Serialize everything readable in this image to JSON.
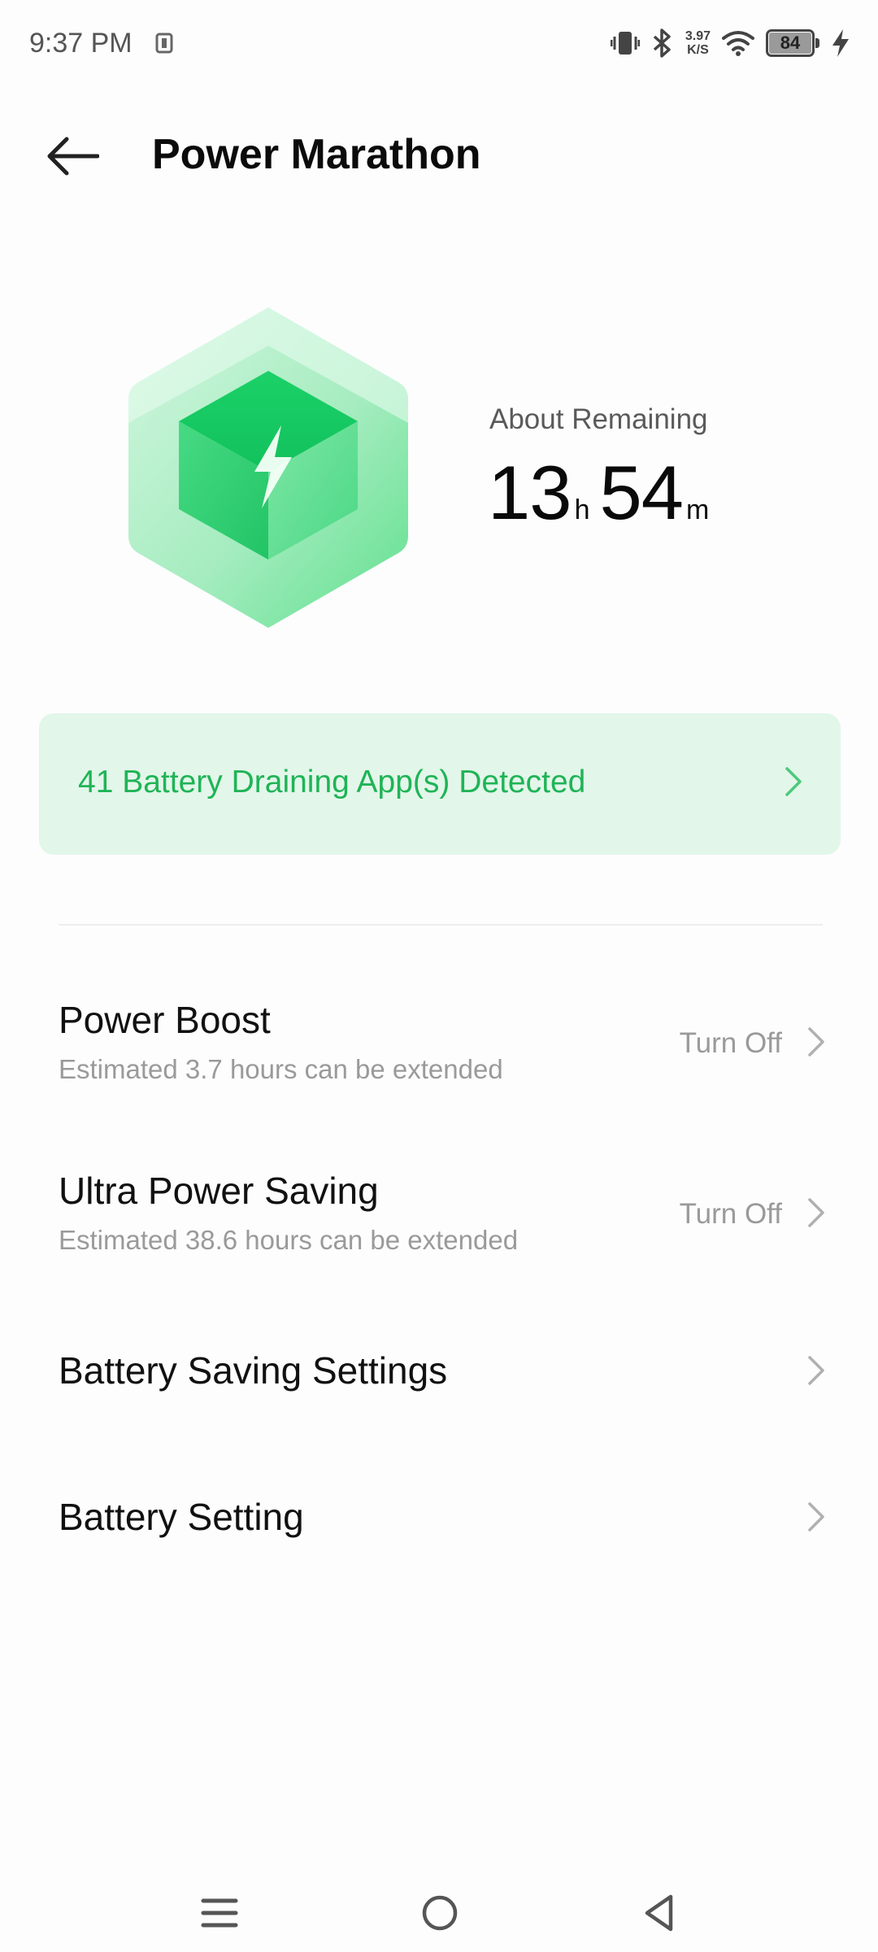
{
  "status_bar": {
    "time": "9:37 PM",
    "netspeed_value": "3.97",
    "netspeed_unit": "K/S",
    "battery_level": "84",
    "icons": [
      "nfc-icon",
      "vibrate-icon",
      "bluetooth-icon",
      "wifi-icon",
      "battery-icon",
      "charging-icon"
    ]
  },
  "header": {
    "title": "Power Marathon",
    "back_icon": "arrow-left-icon"
  },
  "hero": {
    "label": "About Remaining",
    "hours": "13",
    "hours_unit": "h",
    "minutes": "54",
    "minutes_unit": "m",
    "icon": "battery-cube-icon",
    "accent_color": "#22c763"
  },
  "banner": {
    "text": "41 Battery Draining App(s) Detected",
    "text_color": "#1fb456",
    "background": "#e3f6ea"
  },
  "settings": [
    {
      "title": "Power Boost",
      "subtitle": "Estimated 3.7 hours can be extended",
      "status": "Turn Off"
    },
    {
      "title": "Ultra Power Saving",
      "subtitle": "Estimated 38.6 hours can be extended",
      "status": "Turn Off"
    },
    {
      "title": "Battery Saving Settings"
    },
    {
      "title": "Battery Setting"
    }
  ],
  "nav_bar": {
    "icons": [
      "menu-icon",
      "home-icon",
      "back-triangle-icon"
    ]
  }
}
